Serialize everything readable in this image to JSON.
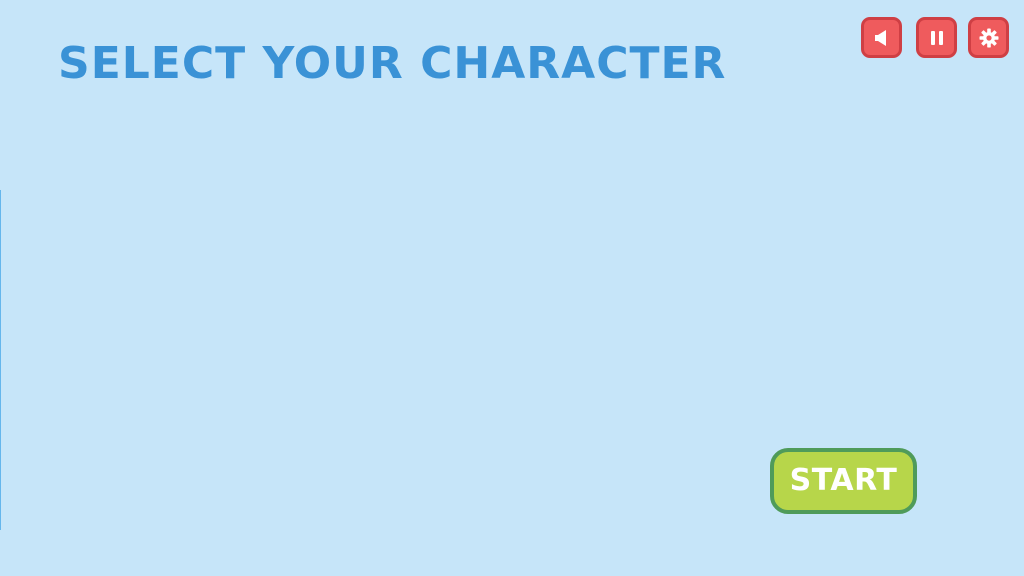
{
  "screen": {
    "title": "SELECT YOUR CHARACTER"
  },
  "toolbar": {
    "sound_icon": "speaker-icon",
    "pause_icon": "pause-icon",
    "settings_icon": "gear-icon",
    "button_color": "#ef5b5d"
  },
  "start": {
    "label": "START",
    "color": "#b7d64a",
    "border_color": "#4f9b5a"
  },
  "theme": {
    "background": "#c6e5f9",
    "title_color": "#3a92d6"
  }
}
